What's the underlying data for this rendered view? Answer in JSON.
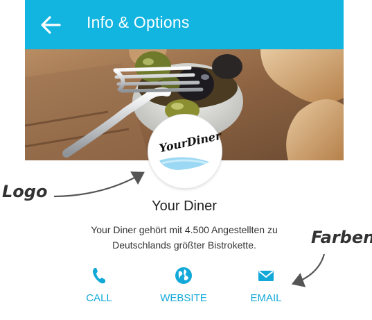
{
  "header": {
    "title": "Info & Options",
    "back_icon": "arrow-left-icon",
    "color": "#12b4e0"
  },
  "hero": {
    "image": "food-photo"
  },
  "logo": {
    "text": "YourDiner"
  },
  "restaurant": {
    "name": "Your Diner",
    "description_line1": "Your Diner gehört mit 4.500 Angestellten zu",
    "description_line2": "Deutschlands größter Bistrokette."
  },
  "actions": [
    {
      "label": "CALL",
      "icon": "phone-icon"
    },
    {
      "label": "WEBSITE",
      "icon": "globe-icon"
    },
    {
      "label": "EMAIL",
      "icon": "envelope-icon"
    }
  ],
  "annotations": {
    "logo": "Logo",
    "colors": "Farben"
  },
  "accent_color": "#12a8d8"
}
